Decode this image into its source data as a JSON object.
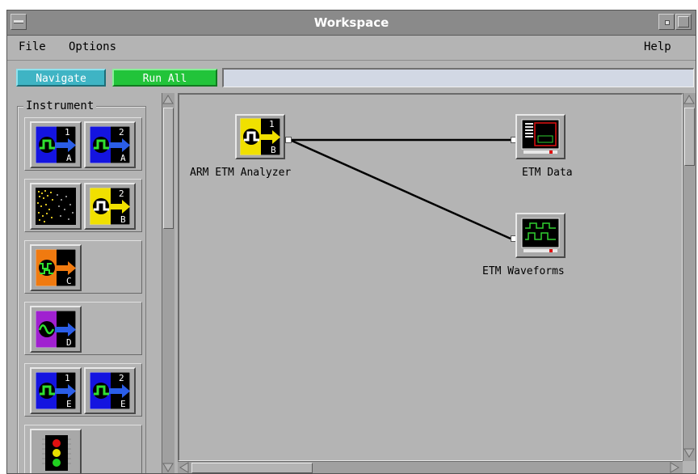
{
  "window": {
    "title": "Workspace"
  },
  "menu": {
    "file": "File",
    "options": "Options",
    "help": "Help"
  },
  "toolbar": {
    "navigate": "Navigate",
    "run_all": "Run All",
    "command_value": ""
  },
  "palette": {
    "title": "Instrument"
  },
  "workspace": {
    "nodes": [
      {
        "label": "ARM ETM Analyzer",
        "icon": "analyzer-icon",
        "badge_number": "1",
        "badge_letter": "B"
      },
      {
        "label": "ETM Data",
        "icon": "listing-display-icon"
      },
      {
        "label": "ETM Waveforms",
        "icon": "waveform-display-icon"
      }
    ]
  },
  "colors": {
    "title_bar": "#8a8a8a",
    "navigate": "#3fb4c4",
    "run_all": "#22c43a",
    "canvas": "#b4b4b4"
  }
}
